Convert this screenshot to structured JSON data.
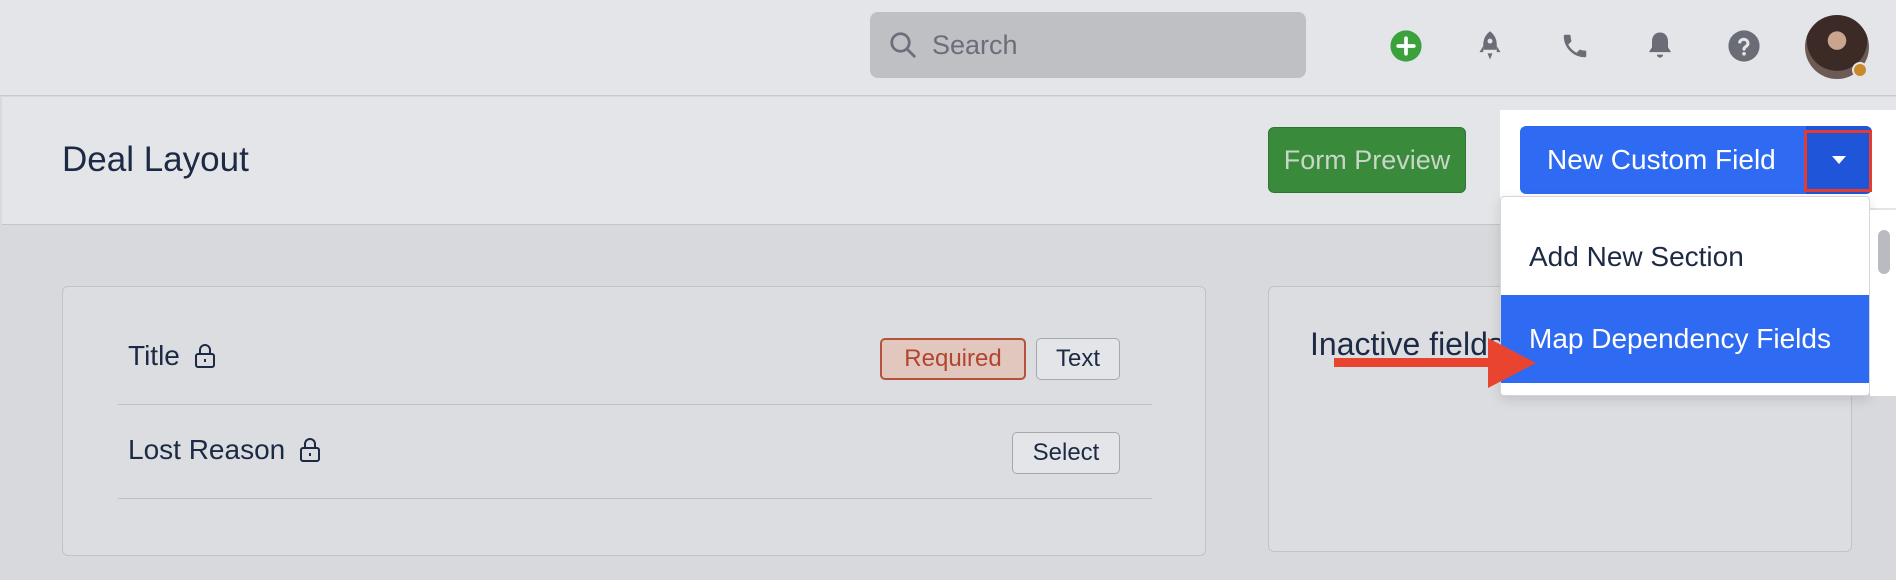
{
  "topbar": {
    "search_placeholder": "Search",
    "icons": [
      "plus-circle-icon",
      "rocket-icon",
      "phone-icon",
      "bell-icon",
      "help-icon"
    ],
    "accent_green": "#3aa13d"
  },
  "header": {
    "title": "Deal Layout",
    "form_preview_label": "Form Preview",
    "new_custom_field_label": "New Custom Field"
  },
  "dropdown": {
    "items": [
      {
        "label": "Add New Section",
        "active": false
      },
      {
        "label": "Map Dependency Fields",
        "active": true
      }
    ]
  },
  "fields": [
    {
      "label": "Title",
      "locked": true,
      "badges": [
        "Required",
        "Text"
      ]
    },
    {
      "label": "Lost Reason",
      "locked": true,
      "badges": [
        "Select"
      ]
    }
  ],
  "inactive": {
    "title": "Inactive fields"
  },
  "colors": {
    "primary": "#2f6bf2",
    "success": "#3a8a3c",
    "required": "#b04530",
    "annotation": "#e84430"
  }
}
